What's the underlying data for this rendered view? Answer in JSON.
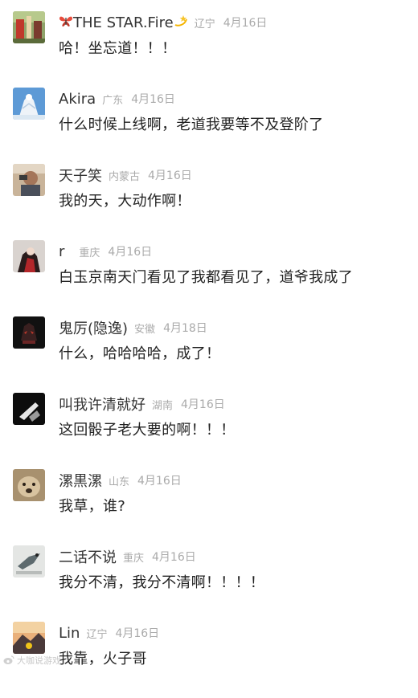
{
  "comments": [
    {
      "username": "THE STAR.Fire",
      "prefix_icon": "butterfly-icon",
      "suffix_icon": "dizzy-star-icon",
      "location": "辽宁",
      "date": "4月16日",
      "text": "哈！坐忘道！！！",
      "avatar": "colorful-scene-avatar"
    },
    {
      "username": "Akira",
      "location": "广东",
      "date": "4月16日",
      "text": "什么时候上线啊，老道我要等不及登阶了",
      "avatar": "snow-figure-avatar"
    },
    {
      "username": "天子笑",
      "location": "内蒙古",
      "date": "4月16日",
      "text": "我的天，大动作啊！",
      "avatar": "portrait-avatar"
    },
    {
      "username": "r",
      "location": "重庆",
      "date": "4月16日",
      "text": "白玉京南天门看见了我都看见了，道爷我成了",
      "avatar": "red-figure-avatar"
    },
    {
      "username": "鬼厉(隐逸)",
      "location": "安徽",
      "date": "4月18日",
      "text": "什么，哈哈哈哈，成了！",
      "avatar": "dark-mask-avatar"
    },
    {
      "username": "叫我许清就好",
      "location": "湖南",
      "date": "4月16日",
      "text": "这回骰子老大要的啊！！！",
      "avatar": "dark-hand-avatar"
    },
    {
      "username": "漯黒漯",
      "location": "山东",
      "date": "4月16日",
      "text": "我草，谁?",
      "avatar": "dog-avatar"
    },
    {
      "username": "二话不说",
      "location": "重庆",
      "date": "4月16日",
      "text": "我分不清，我分不清啊！！！！",
      "avatar": "bird-avatar"
    },
    {
      "username": "Lin",
      "location": "辽宁",
      "date": "4月16日",
      "text": "我靠，火子哥",
      "avatar": "sunset-mountain-avatar"
    }
  ],
  "watermark": {
    "text": "大咖说游戏",
    "icon": "weibo-icon"
  }
}
